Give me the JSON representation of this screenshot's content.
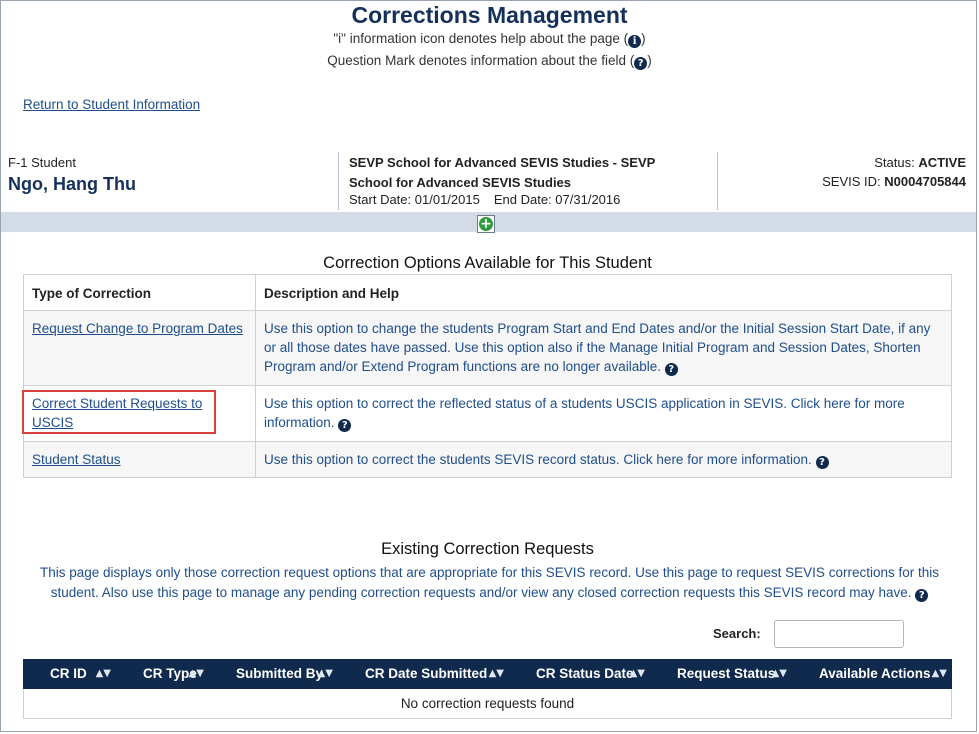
{
  "header": {
    "title": "Corrections Management",
    "note_info": "\"i\" information icon denotes help about the page (",
    "note_info_end": ")",
    "note_question": "Question Mark denotes information about the field (",
    "note_question_end": ")"
  },
  "return_link": "Return to Student Information",
  "student": {
    "type": "F-1 Student",
    "name": "Ngo, Hang Thu",
    "school": "SEVP School for Advanced SEVIS Studies - SEVP School for Advanced SEVIS Studies",
    "start_label": "Start Date:",
    "start_date": "01/01/2015",
    "end_label": "End Date:",
    "end_date": "07/31/2016",
    "status_label": "Status:",
    "status": "ACTIVE",
    "sevis_label": "SEVIS ID:",
    "sevis_id": "N0004705844"
  },
  "options": {
    "title": "Correction Options Available for This Student",
    "col_type": "Type of Correction",
    "col_desc": "Description and Help",
    "rows": [
      {
        "label": "Request Change to Program Dates",
        "desc": "Use this option to change the students Program Start and End Dates and/or the Initial Session Start Date, if any or all those dates have passed. Use this option also if the Manage Initial Program and Session Dates, Shorten Program and/or Extend Program functions are no longer available."
      },
      {
        "label": "Correct Student Requests to USCIS",
        "desc": "Use this option to correct the reflected status of a students USCIS application in SEVIS. Click here for more information."
      },
      {
        "label": "Student Status",
        "desc": "Use this option to correct the students SEVIS record status. Click here for more information."
      }
    ]
  },
  "existing": {
    "title": "Existing Correction Requests",
    "desc": "This page displays only those correction request options that are appropriate for this SEVIS record. Use this page to request SEVIS corrections for this student. Also use this page to manage any pending correction requests and/or view any closed correction requests this SEVIS record may have.",
    "search_label": "Search:",
    "search_value": "",
    "columns": [
      "CR ID",
      "CR Type",
      "Submitted By",
      "CR Date Submitted",
      "CR Status Date",
      "Request Status",
      "Available Actions"
    ],
    "empty": "No correction requests found"
  },
  "icons": {
    "info": "info-circle-icon",
    "help": "question-circle-icon",
    "expand": "plus-circle-icon",
    "sort": "sort-arrows-icon"
  },
  "colors": {
    "title": "#15305b",
    "link": "#1f4e8c",
    "table_header": "#0f2a4d",
    "band": "#d3dbe6",
    "highlight": "#d9413d",
    "expand": "#2f9b3e"
  }
}
